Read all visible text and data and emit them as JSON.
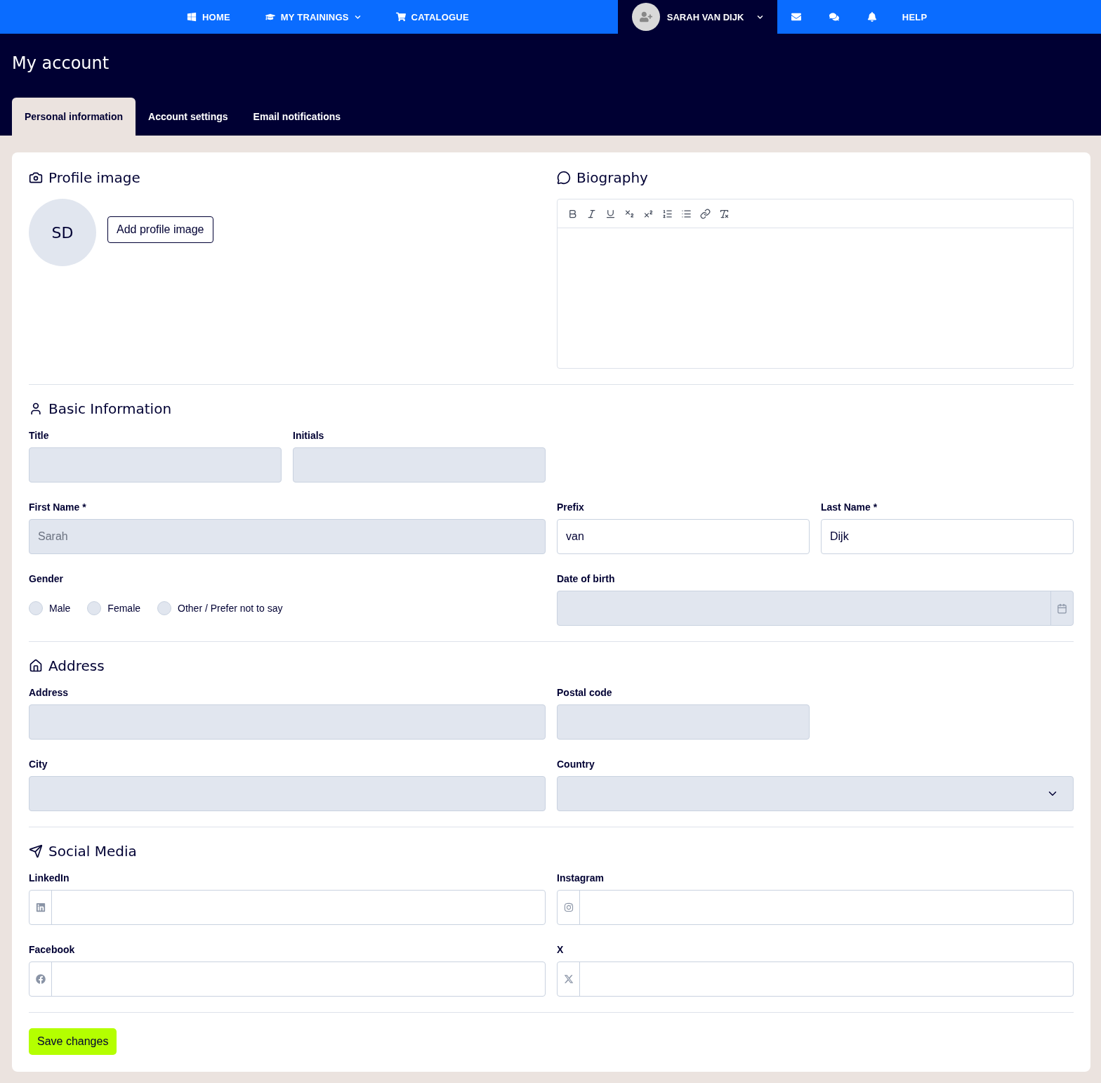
{
  "nav": {
    "links": [
      {
        "label": "HOME",
        "dropdown": false
      },
      {
        "label": "MY TRAININGS",
        "dropdown": true
      },
      {
        "label": "CATALOGUE",
        "dropdown": false
      }
    ],
    "user": {
      "name": "SARAH VAN DIJK",
      "dropdown": true
    },
    "help": "HELP"
  },
  "page_title": "My account",
  "tabs": [
    {
      "label": "Personal information",
      "selected": true
    },
    {
      "label": "Account settings",
      "selected": false
    },
    {
      "label": "Email notifications",
      "selected": false
    }
  ],
  "profile_image": {
    "title": "Profile image",
    "initials": "SD",
    "button": "Add profile image"
  },
  "biography": {
    "title": "Biography"
  },
  "basic_information": {
    "title": "Basic Information",
    "fields": [
      {
        "kind": "text",
        "label": "Title",
        "disabled": true
      },
      {
        "kind": "text",
        "label": "Initials",
        "disabled": true
      },
      {
        "kind": "text",
        "label": "First Name *",
        "value": "Sarah",
        "disabled": true
      },
      {
        "kind": "text",
        "label": "Prefix",
        "value": "van",
        "disabled": false
      },
      {
        "kind": "text",
        "label": "Last Name *",
        "value": "Dijk",
        "disabled": false
      },
      {
        "kind": "radio",
        "label": "Gender",
        "options": [
          {
            "label": "Male",
            "selected": false
          },
          {
            "label": "Female",
            "selected": false
          },
          {
            "label": "Other / Prefer not to say",
            "selected": false
          }
        ]
      },
      {
        "kind": "date",
        "label": "Date of birth",
        "disabled": true
      }
    ]
  },
  "address": {
    "title": "Address",
    "fields": [
      {
        "kind": "text",
        "label": "Address",
        "disabled": true
      },
      {
        "kind": "text",
        "label": "Postal code",
        "disabled": true
      },
      {
        "kind": "text",
        "label": "City",
        "disabled": true
      },
      {
        "kind": "select",
        "label": "Country",
        "disabled": true
      }
    ]
  },
  "social_media": {
    "title": "Social Media",
    "fields": [
      {
        "kind": "social",
        "label": "LinkedIn",
        "disabled": false
      },
      {
        "kind": "social",
        "label": "Instagram",
        "disabled": false
      },
      {
        "kind": "social",
        "label": "Facebook",
        "disabled": false
      },
      {
        "kind": "social",
        "label": "X",
        "disabled": false
      }
    ]
  },
  "save_button": "Save changes"
}
